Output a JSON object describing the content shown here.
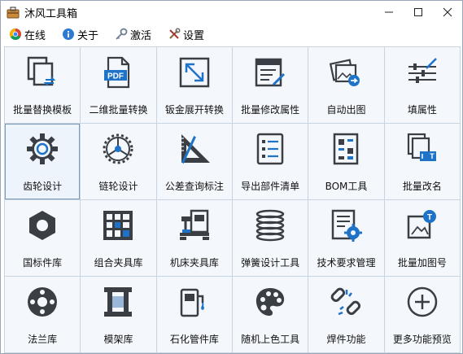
{
  "window": {
    "title": "沐风工具箱"
  },
  "menu": [
    {
      "label": "在线",
      "icon": "chrome-icon"
    },
    {
      "label": "关于",
      "icon": "info-icon"
    },
    {
      "label": "激活",
      "icon": "key-icon"
    },
    {
      "label": "设置",
      "icon": "tools-icon"
    }
  ],
  "tiles": [
    {
      "label": "批量替换模板",
      "icon": "replace-template-icon"
    },
    {
      "label": "二维批量转换",
      "icon": "pdf-icon"
    },
    {
      "label": "钣金展开转换",
      "icon": "expand-arrows-icon"
    },
    {
      "label": "批量修改属性",
      "icon": "edit-properties-icon"
    },
    {
      "label": "自动出图",
      "icon": "auto-drawing-icon"
    },
    {
      "label": "填属性",
      "icon": "sliders-icon"
    },
    {
      "label": "齿轮设计",
      "icon": "gear-icon"
    },
    {
      "label": "链轮设计",
      "icon": "sprocket-icon"
    },
    {
      "label": "公差查询标注",
      "icon": "set-square-icon"
    },
    {
      "label": "导出部件清单",
      "icon": "parts-list-icon"
    },
    {
      "label": "BOM工具",
      "icon": "bom-icon"
    },
    {
      "label": "批量改名",
      "icon": "rename-icon"
    },
    {
      "label": "国标件库",
      "icon": "hex-nut-icon"
    },
    {
      "label": "组合夹具库",
      "icon": "fixture-grid-icon"
    },
    {
      "label": "机床夹具库",
      "icon": "machine-tool-icon"
    },
    {
      "label": "弹簧设计工具",
      "icon": "spring-icon"
    },
    {
      "label": "技术要求管理",
      "icon": "tech-requirements-icon"
    },
    {
      "label": "批量加图号",
      "icon": "add-drawing-number-icon"
    },
    {
      "label": "法兰库",
      "icon": "flange-icon"
    },
    {
      "label": "模架库",
      "icon": "mold-base-icon"
    },
    {
      "label": "石化管件库",
      "icon": "pipe-fitting-icon"
    },
    {
      "label": "随机上色工具",
      "icon": "palette-icon"
    },
    {
      "label": "焊件功能",
      "icon": "weld-link-icon"
    },
    {
      "label": "更多功能预览",
      "icon": "plus-circle-icon"
    }
  ],
  "selected_tile": "齿轮设计",
  "colors": {
    "accent": "#1e73c8",
    "icon_dark": "#3a3f46",
    "grid_line": "#c9d4e2",
    "tile_bg": "#f4f8fc"
  }
}
